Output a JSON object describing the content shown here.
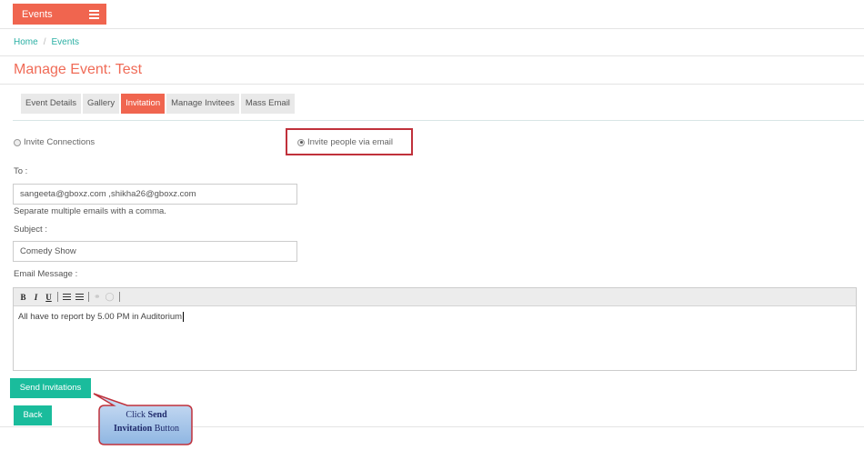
{
  "header": {
    "events_label": "Events",
    "menu_icon": "hamburger-icon"
  },
  "breadcrumb": {
    "home": "Home",
    "separator": "/",
    "current": "Events"
  },
  "page": {
    "title": "Manage Event: Test"
  },
  "tabs": [
    {
      "label": "Event Details",
      "active": false
    },
    {
      "label": "Gallery",
      "active": false
    },
    {
      "label": "Invitation",
      "active": true
    },
    {
      "label": "Manage Invitees",
      "active": false
    },
    {
      "label": "Mass Email",
      "active": false
    }
  ],
  "invite_options": {
    "connections_label": "Invite Connections",
    "email_label": "Invite people via email",
    "selected": "email"
  },
  "form": {
    "to_label": "To :",
    "to_value": "sangeeta@gboxz.com ,shikha26@gboxz.com",
    "to_help": "Separate multiple emails with a comma.",
    "subject_label": "Subject :",
    "subject_value": "Comedy Show",
    "message_label": "Email Message :",
    "message_value": "All have to report by 5.00 PM in Auditorium"
  },
  "editor_toolbar": {
    "bold": "B",
    "italic": "I",
    "underline": "U",
    "icons": [
      "bold-icon",
      "italic-icon",
      "underline-icon",
      "bullet-list-icon",
      "numbered-list-icon",
      "link-icon",
      "unlink-icon"
    ]
  },
  "buttons": {
    "send": "Send Invitations",
    "back": "Back"
  },
  "callout": {
    "prefix": "Click ",
    "bold1": "Send",
    "bold2": "Invitation",
    "suffix": " Button"
  },
  "colors": {
    "accent": "#f0654f",
    "teal": "#1abc9c",
    "link": "#2bb0a4",
    "highlight": "#c0313b",
    "callout_fill": "#9fc4ea"
  }
}
